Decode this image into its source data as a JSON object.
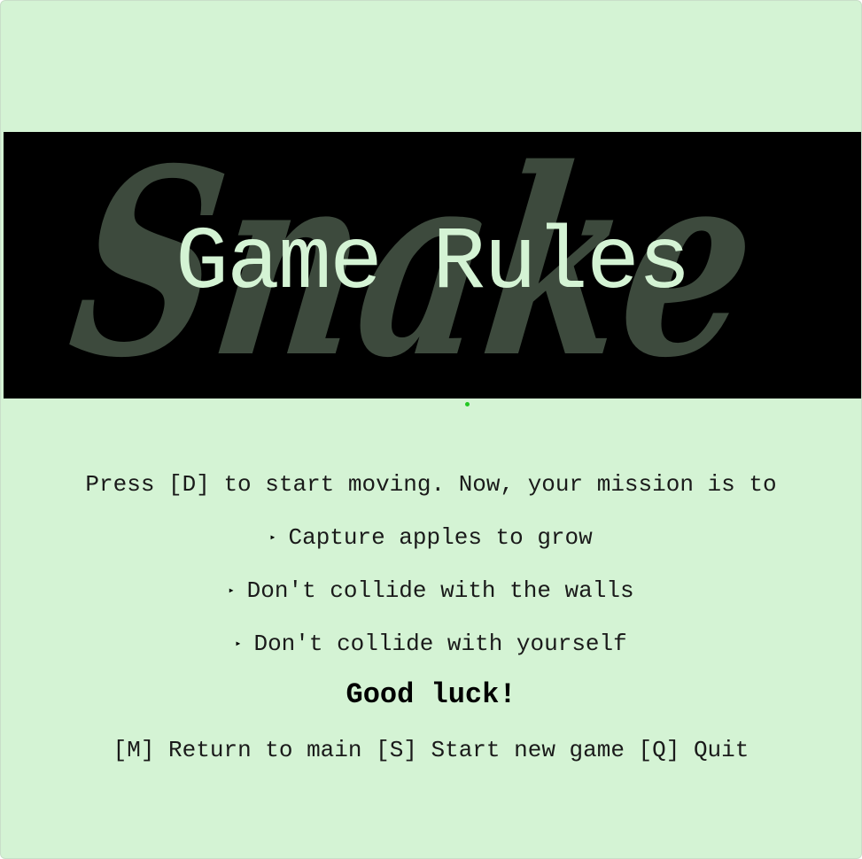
{
  "banner": {
    "watermark": "Snake",
    "title": "Game Rules"
  },
  "rules": {
    "intro": "Press [D] to start moving. Now, your mission is to",
    "bullet_glyph": "▸",
    "items": [
      "Capture apples to grow",
      "Don't collide with the walls",
      "Don't collide with yourself"
    ],
    "closing": "Good luck!"
  },
  "controls": "[M] Return to main [S] Start new game [Q] Quit",
  "colors": {
    "background": "#d4f3d4",
    "banner": "#000000",
    "watermark": "#3d4a3d",
    "title": "#d4f3d4",
    "indicator_dot": "#22c722"
  }
}
